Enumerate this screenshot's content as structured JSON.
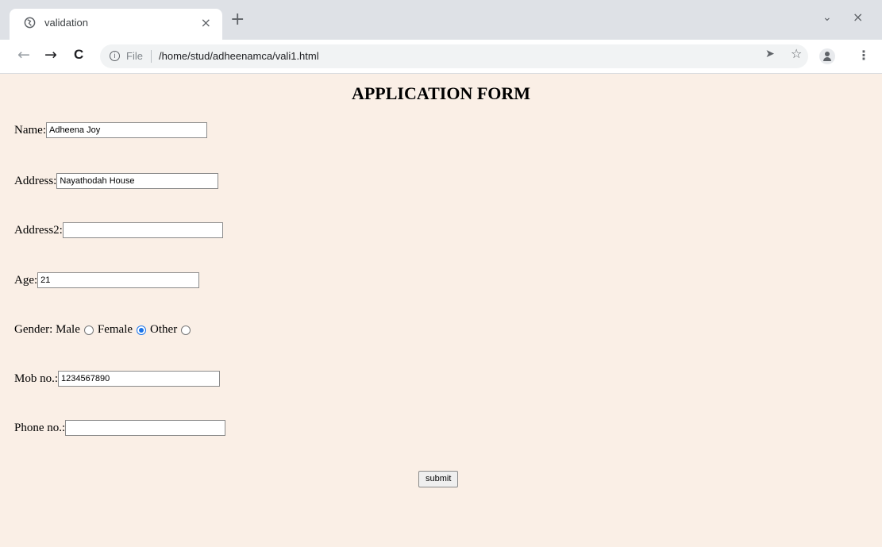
{
  "browser": {
    "tab_title": "validation",
    "tab_close": "×",
    "new_tab": "+",
    "window_minimize": "⌄",
    "window_close": "×",
    "back": "←",
    "forward": "→",
    "reload": "C",
    "info_icon": "i",
    "file_label": "File",
    "url": "/home/stud/adheenamca/vali1.html",
    "share": "➤",
    "star": "☆",
    "menu": "⋮"
  },
  "form": {
    "title": "APPLICATION FORM",
    "name_label": "Name:",
    "name_value": "Adheena Joy",
    "address_label": "Address:",
    "address_value": "Nayathodah House",
    "address2_label": "Address2:",
    "address2_value": "",
    "age_label": "Age:",
    "age_value": "21",
    "gender_label": "Gender:",
    "gender_options": [
      {
        "label": "Male",
        "checked": false
      },
      {
        "label": "Female",
        "checked": true
      },
      {
        "label": "Other",
        "checked": false
      }
    ],
    "mob_label": "Mob no.:",
    "mob_value": "1234567890",
    "phone_label": "Phone no.:",
    "phone_value": "",
    "submit_label": "submit"
  },
  "colors": {
    "page_background": "#faefe6",
    "radio_checked": "#1a73e8"
  }
}
